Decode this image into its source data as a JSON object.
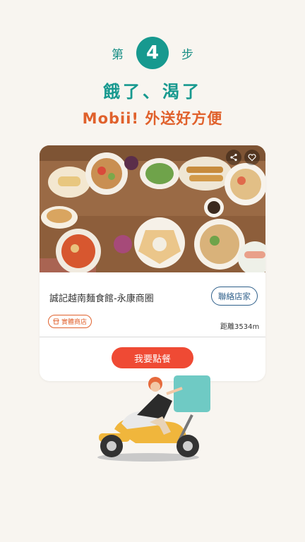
{
  "step": {
    "prefix": "第",
    "number": "4",
    "suffix": "步"
  },
  "headline": "餓了、渴了",
  "subhead": "Mobii! 外送好方便",
  "card": {
    "store_name": "誠記越南麵食館-永康商圈",
    "contact_label": "聯絡店家",
    "badge_label": "實體商店",
    "distance": "距離3534m",
    "order_label": "我要點餐"
  },
  "colors": {
    "teal": "#17998f",
    "orange": "#e0612c",
    "order_red": "#ef4a34",
    "contact_blue": "#2e5f8a",
    "background": "#f8f5f0"
  },
  "icons": [
    "share-icon",
    "heart-icon",
    "store-icon"
  ]
}
